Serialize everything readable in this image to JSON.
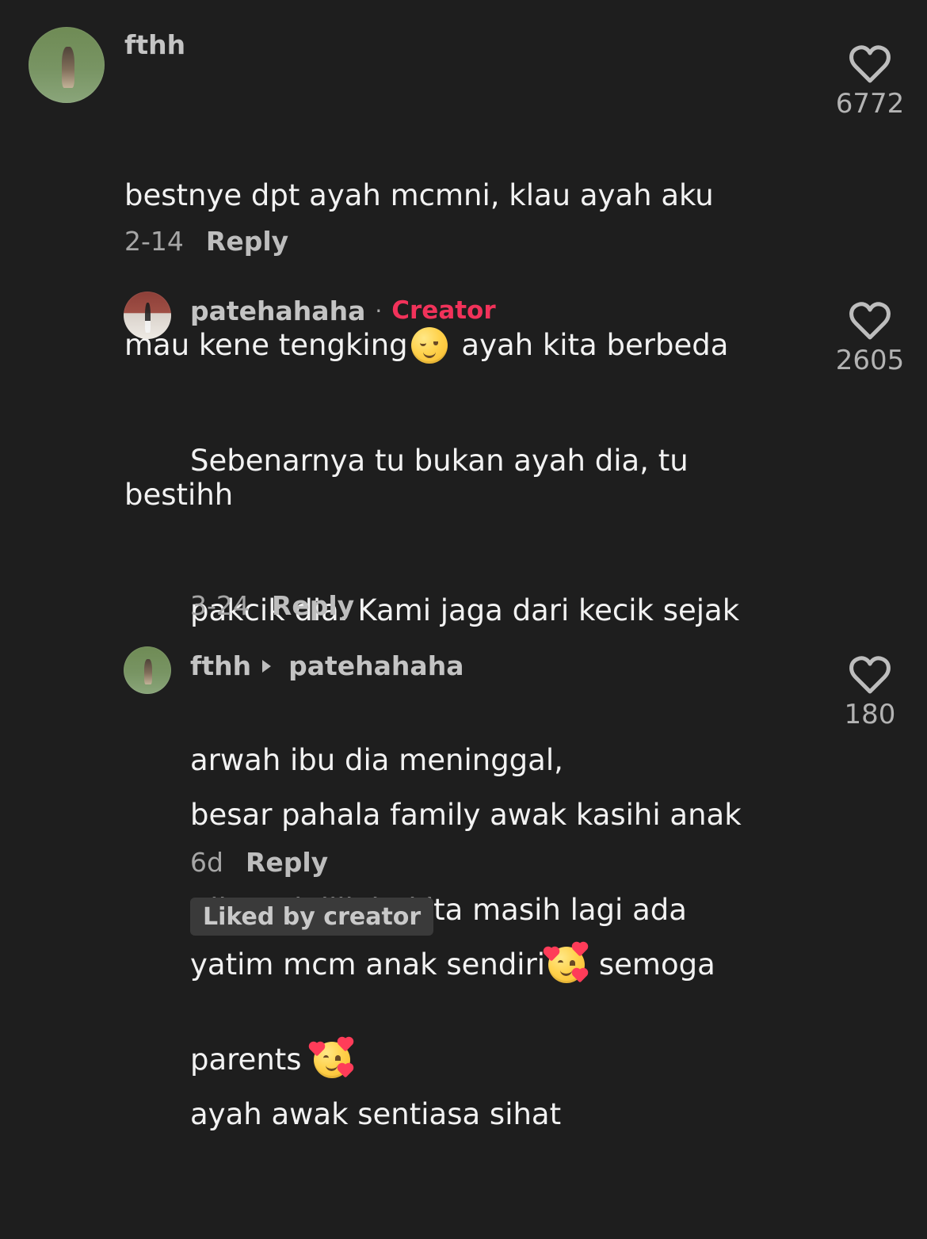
{
  "comments": [
    {
      "username": "fthh",
      "text_lines": [
        [
          "bestnye dpt ayah mcmni, klau ayah aku"
        ],
        [
          "mau kene tengking",
          "relieved-face-emoji",
          " ayah kita berbeda"
        ],
        [
          "bestihh"
        ]
      ],
      "date": "2-14",
      "reply_label": "Reply",
      "likes": "6772",
      "icon": "heart-outline-icon"
    },
    {
      "username": "patehahaha",
      "separator": "·",
      "badge": "Creator",
      "text_lines": [
        [
          "Sebenarnya tu bukan ayah dia, tu"
        ],
        [
          "pakcik dia. Kami jaga dari kecik sejak"
        ],
        [
          "arwah ibu dia meninggal,"
        ],
        [
          "Alhamdulillah, kita masih lagi ada"
        ],
        [
          "parents ",
          "smiling-face-with-hearts-emoji"
        ]
      ],
      "date": "3-24",
      "reply_label": "Reply",
      "likes": "2605",
      "icon": "heart-outline-icon"
    },
    {
      "username": "fthh",
      "reply_to": "patehahaha",
      "text_lines": [
        [
          "besar pahala family awak kasihi anak"
        ],
        [
          "yatim mcm anak sendiri",
          "smiling-face-with-hearts-emoji",
          " semoga"
        ],
        [
          "ayah awak sentiasa sihat"
        ]
      ],
      "date": "6d",
      "reply_label": "Reply",
      "likes": "180",
      "icon": "heart-outline-icon",
      "liked_badge": "Liked by creator"
    }
  ]
}
